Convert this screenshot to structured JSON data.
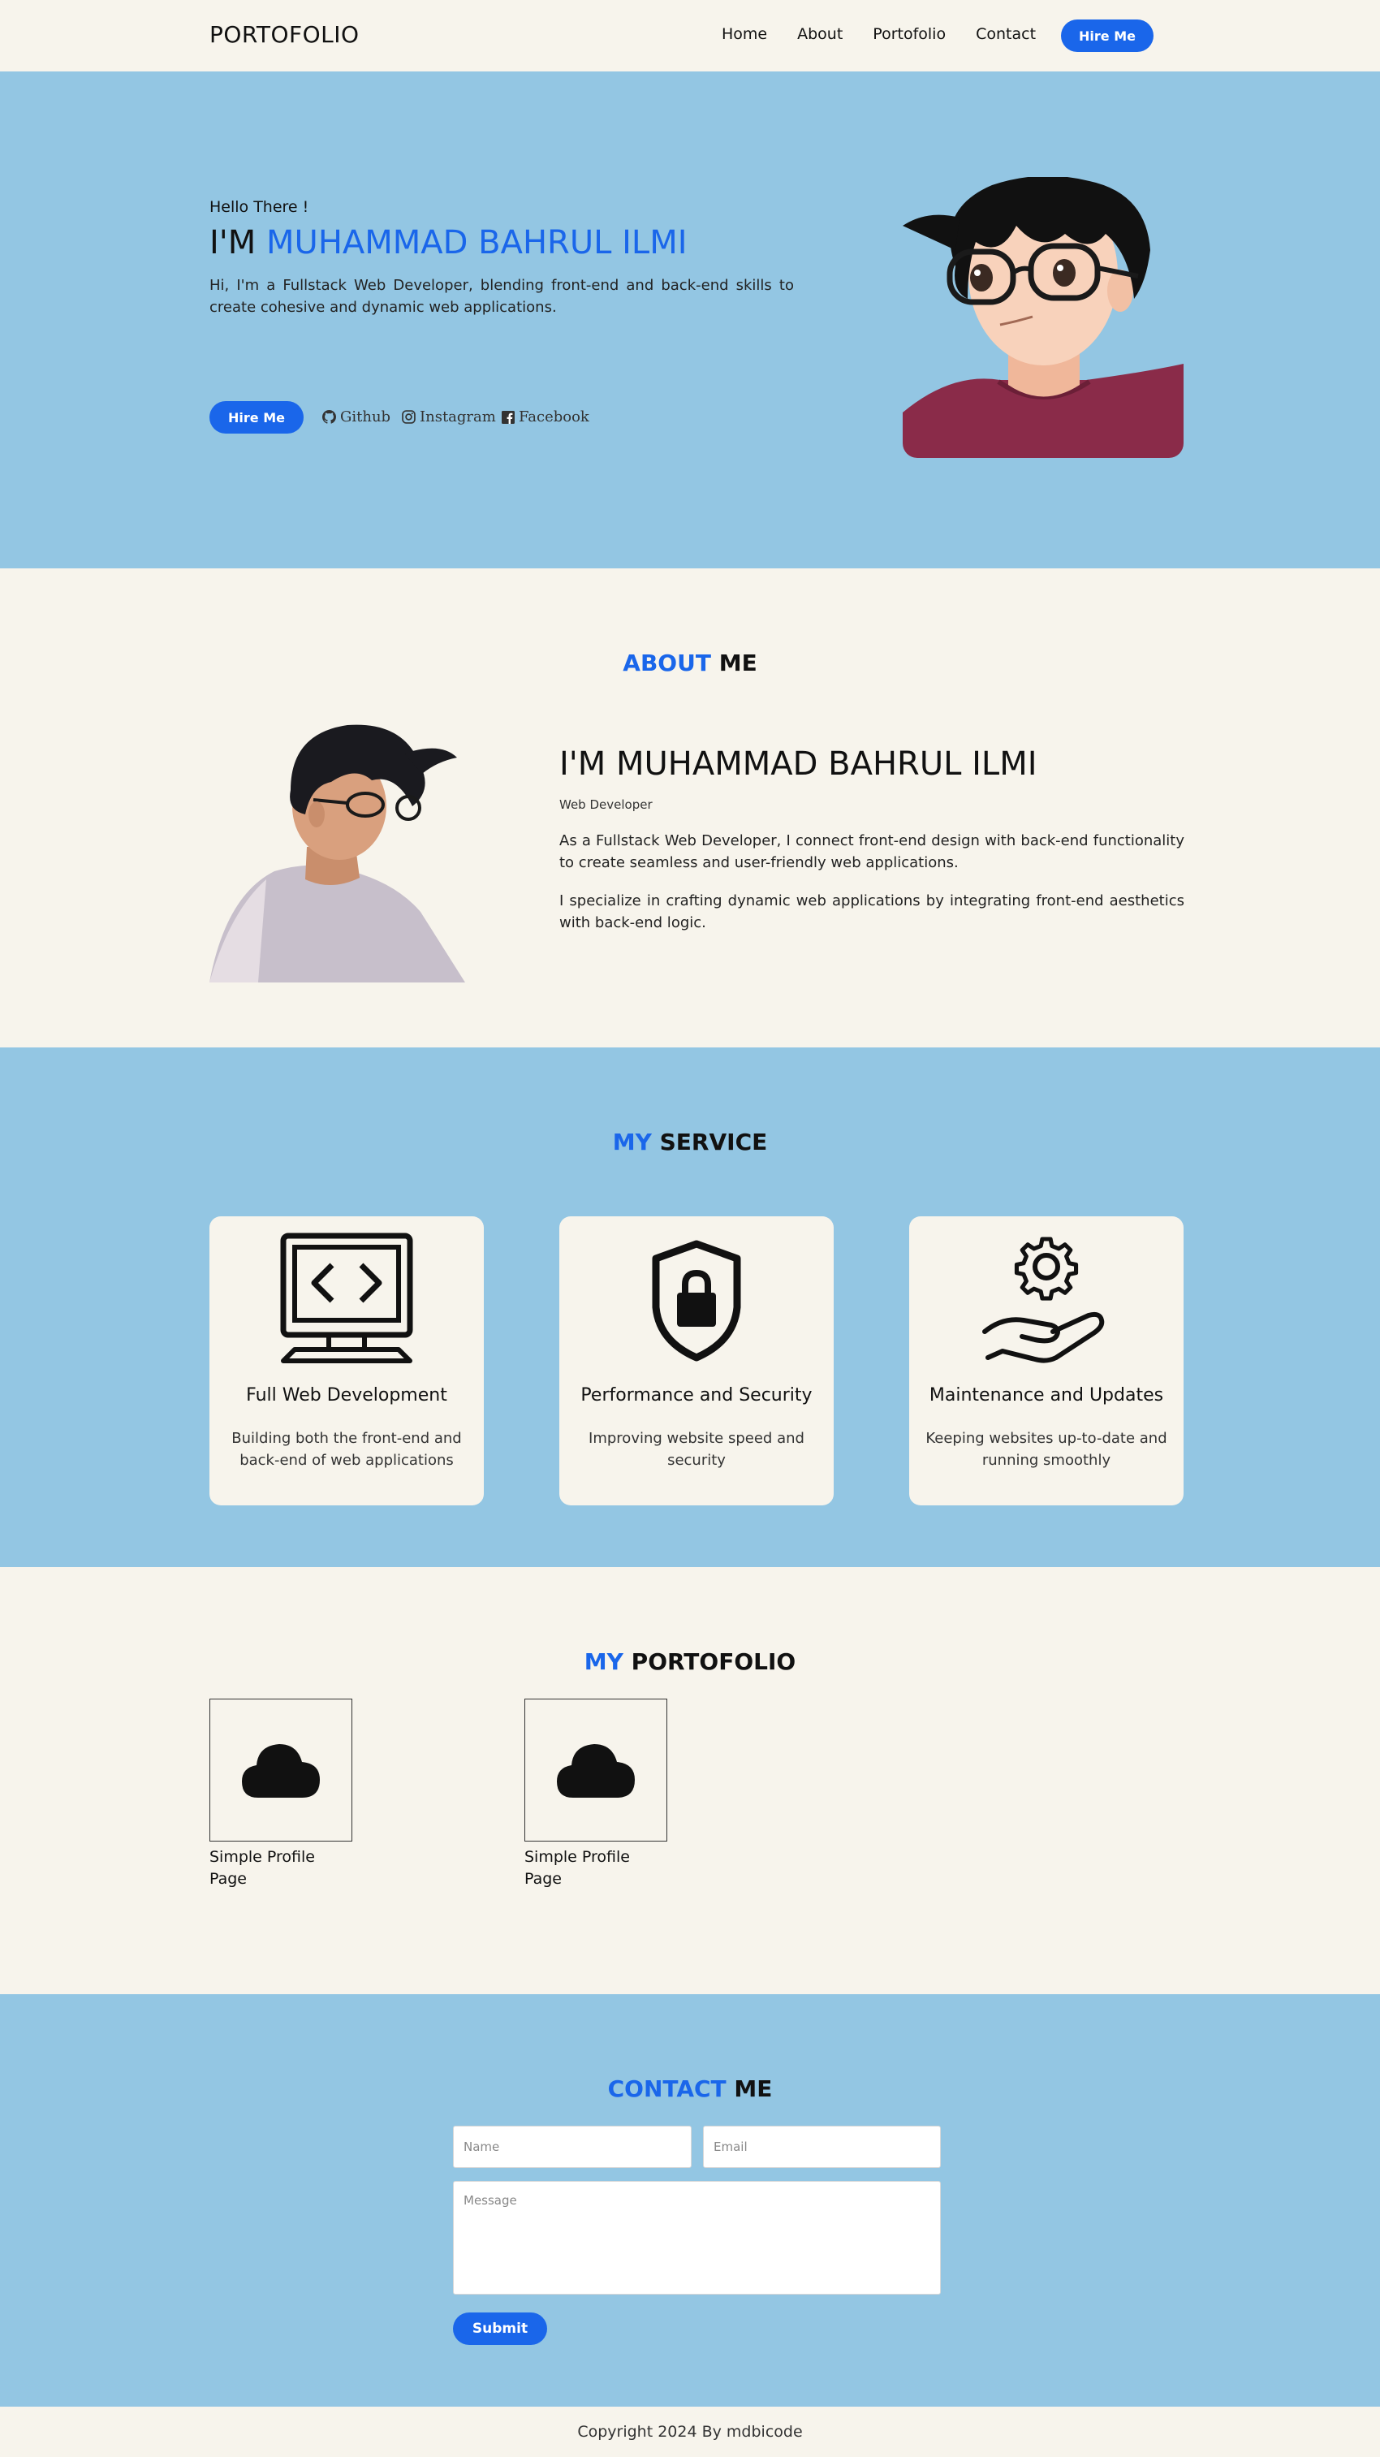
{
  "nav": {
    "logo": "PORTOFOLIO",
    "links": [
      "Home",
      "About",
      "Portofolio",
      "Contact"
    ],
    "hire_label": "Hire Me"
  },
  "hero": {
    "greeting": "Hello There !",
    "title_prefix": "I'M",
    "title_name": "MUHAMMAD BAHRUL ILMI",
    "description": "Hi, I'm a Fullstack Web Developer, blending front-end and back-end skills to create cohesive and dynamic web applications.",
    "hire_label": "Hire Me",
    "socials": [
      {
        "label": "Github",
        "icon": "github-icon"
      },
      {
        "label": "Instagram",
        "icon": "instagram-icon"
      },
      {
        "label": "Facebook",
        "icon": "facebook-icon"
      }
    ]
  },
  "about": {
    "title_highlight": "ABOUT",
    "title_rest": "ME",
    "name": "I'M MUHAMMAD BAHRUL ILMI",
    "role": "Web Developer",
    "paragraphs": [
      "As a Fullstack Web Developer, I connect front-end design with back-end functionality to create seamless and user-friendly web applications.",
      "I specialize in crafting dynamic web applications by integrating front-end aesthetics with back-end logic."
    ]
  },
  "service": {
    "title_highlight": "MY",
    "title_rest": "SERVICE",
    "cards": [
      {
        "title": "Full Web Development",
        "description": "Building both the front-end and back-end of web applications",
        "icon": "computer-code-icon"
      },
      {
        "title": "Performance and Security",
        "description": "Improving website speed and security",
        "icon": "shield-lock-icon"
      },
      {
        "title": "Maintenance and Updates",
        "description": "Keeping websites up-to-date and running smoothly",
        "icon": "gear-hand-icon"
      }
    ]
  },
  "portfolio": {
    "title_highlight": "MY",
    "title_rest": "PORTOFOLIO",
    "items": [
      {
        "label": "Simple Profile Page",
        "icon": "cloud-icon"
      },
      {
        "label": "Simple Profile Page",
        "icon": "cloud-icon"
      }
    ]
  },
  "contact": {
    "title_highlight": "CONTACT",
    "title_rest": "ME",
    "name_placeholder": "Name",
    "email_placeholder": "Email",
    "message_placeholder": "Message",
    "submit_label": "Submit"
  },
  "footer": {
    "copyright": "Copyright 2024 By mdbicode"
  },
  "colors": {
    "accent": "#1a66ea",
    "sky": "#93c6e3",
    "cream": "#f7f4ec"
  }
}
